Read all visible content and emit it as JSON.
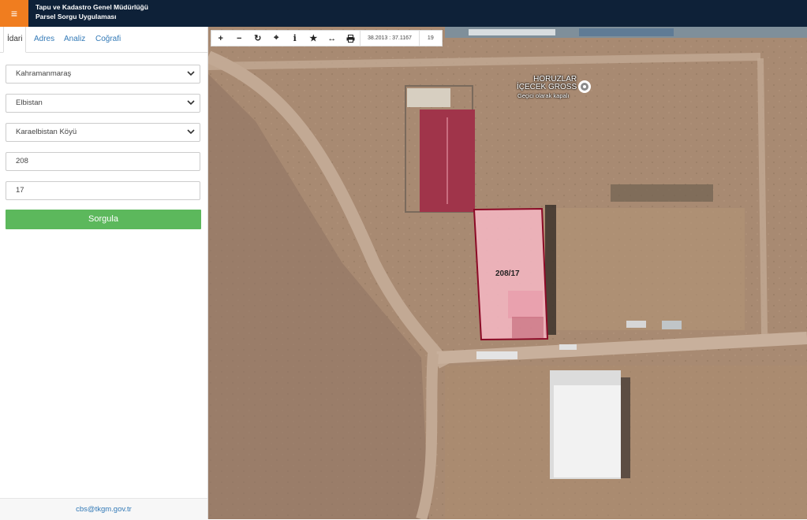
{
  "header": {
    "menu_icon": "hamburger-icon",
    "title_line1": "Tapu ve Kadastro Genel Müdürlüğü",
    "title_line2": "Parsel Sorgu Uygulaması",
    "colors": {
      "bar": "#0e2138",
      "menu": "#f07d1f"
    }
  },
  "sidebar": {
    "tabs": [
      {
        "label": "İdari",
        "active": true
      },
      {
        "label": "Adres"
      },
      {
        "label": "Analiz"
      },
      {
        "label": "Coğrafi"
      }
    ],
    "fields": {
      "province": "Kahramanmaraş",
      "district": "Elbistan",
      "neighborhood": "Karaelbistan Köyü",
      "block": "208",
      "parcel": "17"
    },
    "submit_label": "Sorgula",
    "submit_color": "#5cb85c",
    "footer_email": "cbs@tkgm.gov.tr"
  },
  "map": {
    "toolbar": {
      "buttons": [
        "zoom-in-icon",
        "zoom-out-icon",
        "refresh-icon",
        "locate-icon",
        "info-icon",
        "favorite-icon",
        "measure-icon",
        "print-icon"
      ],
      "coordinates": "38.2013 : 37.1167",
      "zoom": "19"
    },
    "parcel_label": "208/17",
    "parcel_outline_color": "#8b0a26",
    "poi": {
      "name_line1": "HORUZLAR",
      "name_line2": "İÇECEK GROSS",
      "status": "Geçici olarak kapalı"
    }
  }
}
